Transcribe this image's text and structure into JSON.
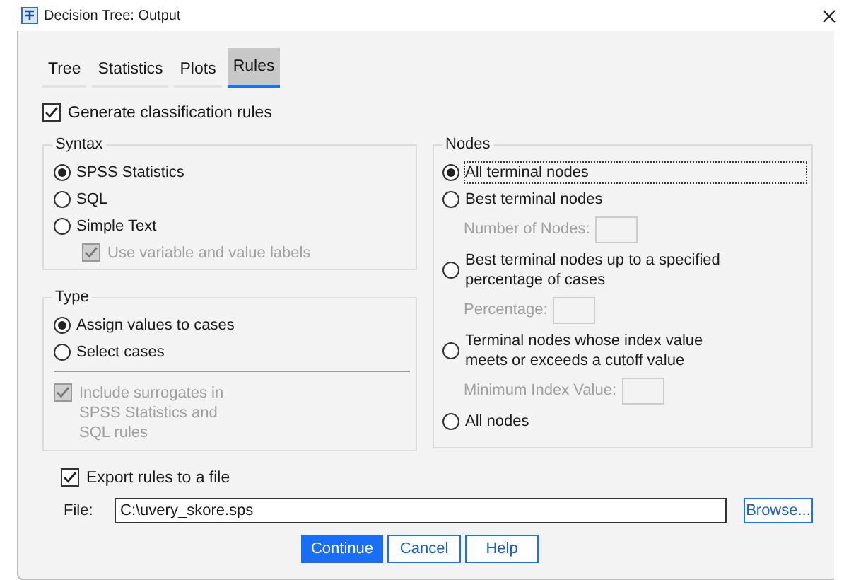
{
  "window": {
    "title": "Decision Tree: Output"
  },
  "tabs": [
    {
      "label": "Tree",
      "selected": false
    },
    {
      "label": "Statistics",
      "selected": false
    },
    {
      "label": "Plots",
      "selected": false
    },
    {
      "label": "Rules",
      "selected": true
    }
  ],
  "generate_rules": {
    "label": "Generate classification rules",
    "checked": true
  },
  "syntax": {
    "title": "Syntax",
    "options": [
      {
        "label": "SPSS Statistics",
        "selected": true
      },
      {
        "label": "SQL",
        "selected": false
      },
      {
        "label": "Simple Text",
        "selected": false
      }
    ],
    "use_labels": {
      "label": "Use variable and value labels",
      "checked": true,
      "disabled": true
    }
  },
  "type": {
    "title": "Type",
    "options": [
      {
        "label": "Assign values to cases",
        "selected": true
      },
      {
        "label": "Select cases",
        "selected": false
      }
    ],
    "include_surrogates": {
      "label": "Include surrogates in SPSS Statistics and SQL rules",
      "checked": true,
      "disabled": true
    }
  },
  "nodes": {
    "title": "Nodes",
    "options": [
      {
        "label": "All terminal nodes",
        "selected": true,
        "focused": true
      },
      {
        "label": "Best terminal nodes",
        "selected": false,
        "focused": false,
        "field": {
          "label": "Number of Nodes:",
          "disabled": true
        }
      },
      {
        "label": "Best terminal nodes up to a specified percentage of cases",
        "selected": false,
        "focused": false,
        "field": {
          "label": "Percentage:",
          "disabled": true
        }
      },
      {
        "label": "Terminal nodes whose index value meets or exceeds a cutoff value",
        "selected": false,
        "focused": false,
        "field": {
          "label": "Minimum Index Value:",
          "disabled": true
        }
      },
      {
        "label": "All nodes",
        "selected": false,
        "focused": false
      }
    ]
  },
  "export": {
    "label": "Export rules to a file",
    "checked": true
  },
  "file": {
    "label": "File:",
    "value": "C:\\uvery_skore.sps"
  },
  "browse_button": "Browse...",
  "buttons": [
    {
      "label": "Continue",
      "default": true
    },
    {
      "label": "Cancel",
      "default": false
    },
    {
      "label": "Help",
      "default": false
    }
  ]
}
